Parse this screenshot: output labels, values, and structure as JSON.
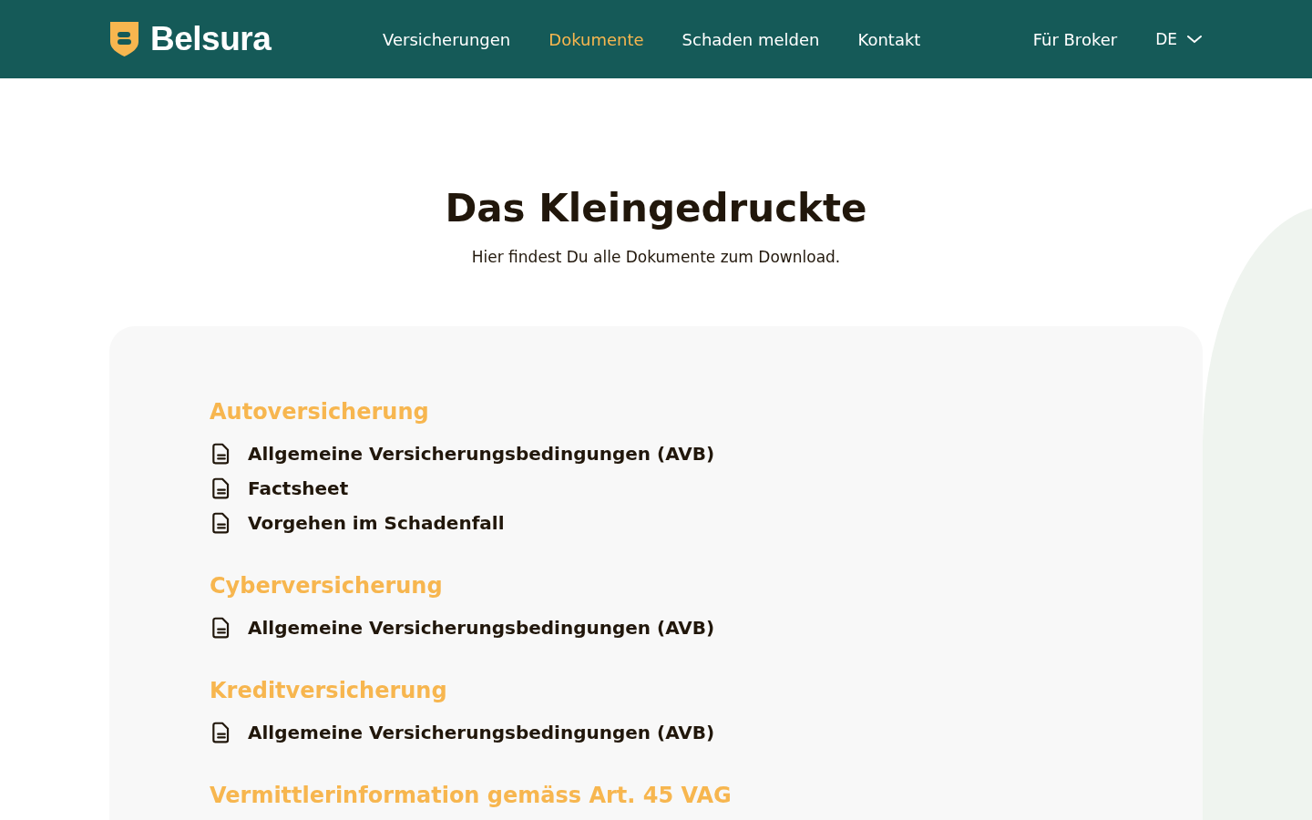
{
  "header": {
    "logo": "Belsura",
    "nav": [
      {
        "label": "Versicherungen",
        "selected": false
      },
      {
        "label": "Dokumente",
        "selected": true
      },
      {
        "label": "Schaden melden",
        "selected": false
      },
      {
        "label": "Kontakt",
        "selected": false
      }
    ],
    "broker_link": "Für Broker",
    "language": "DE"
  },
  "hero": {
    "title": "Das Kleingedruckte",
    "subtitle": "Hier findest Du alle Dokumente zum Download."
  },
  "sections": [
    {
      "heading": "Autoversicherung",
      "documents": [
        "Allgemeine Versicherungsbedingungen (AVB)",
        "Factsheet",
        "Vorgehen im Schadenfall"
      ]
    },
    {
      "heading": "Cyberversicherung",
      "documents": [
        "Allgemeine Versicherungsbedingungen (AVB)"
      ]
    },
    {
      "heading": "Kreditversicherung",
      "documents": [
        "Allgemeine Versicherungsbedingungen (AVB)"
      ]
    },
    {
      "heading": "Vermittlerinformation gemäss Art. 45 VAG"
    }
  ]
}
